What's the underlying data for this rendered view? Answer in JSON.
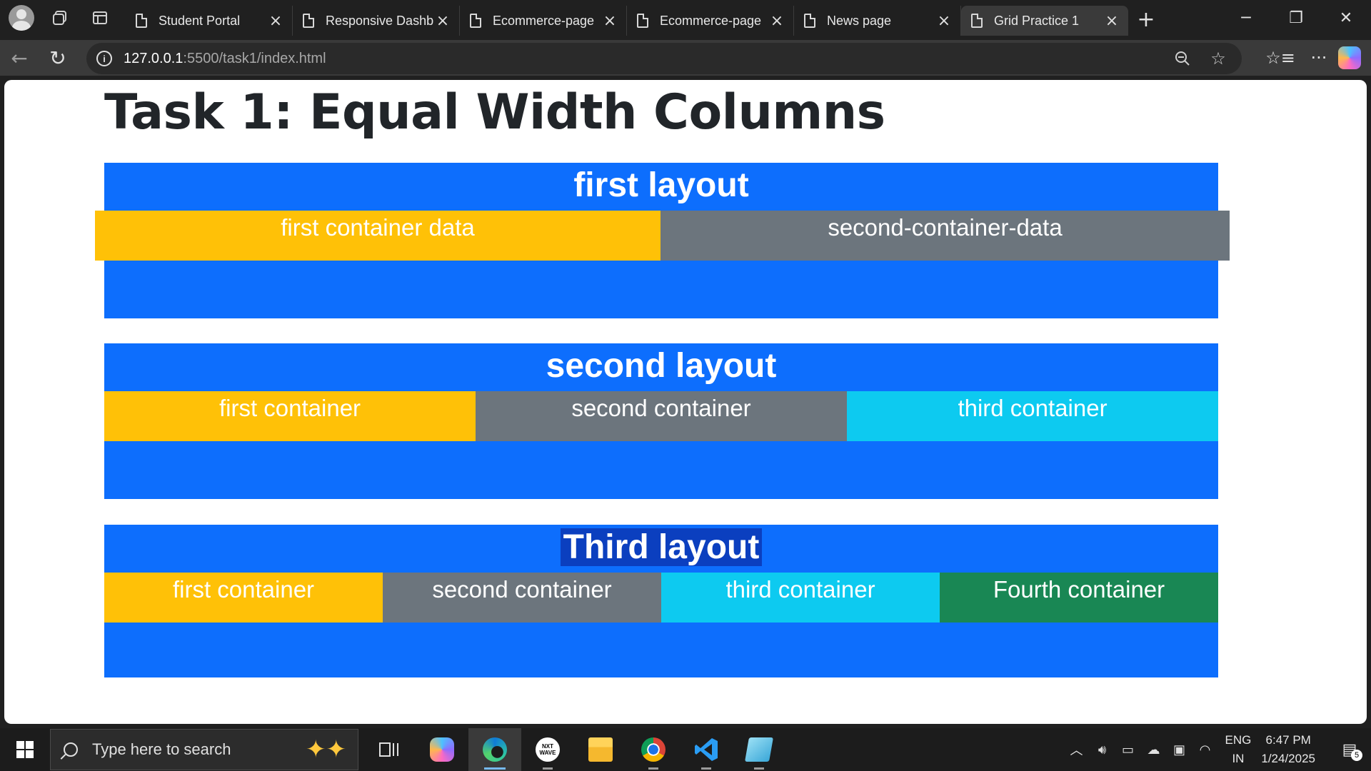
{
  "browser": {
    "tabs": [
      {
        "title": "Student Portal",
        "active": false
      },
      {
        "title": "Responsive Dashb",
        "active": false
      },
      {
        "title": "Ecommerce-page",
        "active": false
      },
      {
        "title": "Ecommerce-page",
        "active": false
      },
      {
        "title": "News page",
        "active": false
      },
      {
        "title": "Grid Practice 1",
        "active": true
      }
    ],
    "url_host": "127.0.0.1",
    "url_path": ":5500/task1/index.html"
  },
  "page": {
    "heading": "Task 1: Equal Width Columns",
    "layouts": [
      {
        "title": "first layout",
        "containers": [
          "first container data",
          "second-container-data"
        ]
      },
      {
        "title": "second layout",
        "containers": [
          "first container",
          "second container",
          "third container"
        ]
      },
      {
        "title": "Third layout",
        "containers": [
          "first container",
          "second container",
          "third container",
          "Fourth container"
        ]
      }
    ],
    "colors": {
      "layout_bg": "#0d6efd",
      "yellow": "#ffc107",
      "gray": "#6c757d",
      "cyan": "#0dcaf0",
      "green": "#198754"
    }
  },
  "taskbar": {
    "search_placeholder": "Type here to search",
    "pinned": [
      "task-view-icon",
      "copilot-icon",
      "edge-icon",
      "nxtwave-icon",
      "file-explorer-icon",
      "chrome-icon",
      "vscode-icon",
      "notepad-icon"
    ],
    "nxtwave_label": "NXT WAVE",
    "language": "ENG",
    "region": "IN",
    "time": "6:47 PM",
    "date": "1/24/2025",
    "notification_count": "5"
  }
}
